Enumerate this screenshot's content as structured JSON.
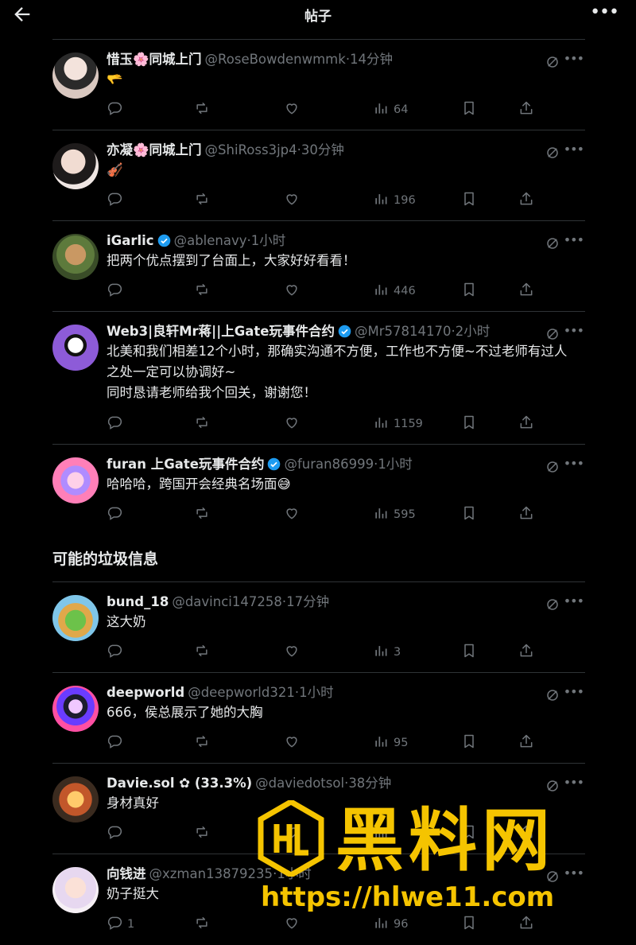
{
  "header": {
    "title": "帖子"
  },
  "section_label": "可能的垃圾信息",
  "posts": [
    {
      "name": "惜玉🌸同城上门",
      "verified": false,
      "handle": "@RoseBowdenwmmk",
      "time": "14分钟",
      "text": "🫳",
      "replies": "",
      "reposts": "",
      "likes": "",
      "views": "64"
    },
    {
      "name": "亦凝🌸同城上门",
      "verified": false,
      "handle": "@ShiRoss3jp4",
      "time": "30分钟",
      "text": "🎻",
      "replies": "",
      "reposts": "",
      "likes": "",
      "views": "196"
    },
    {
      "name": "iGarlic",
      "verified": true,
      "handle": "@ablenavy",
      "time": "1小时",
      "text": "把两个优点摆到了台面上，大家好好看看！",
      "replies": "",
      "reposts": "",
      "likes": "",
      "views": "446"
    },
    {
      "name": "Web3|良轩Mr蒋||上Gate玩事件合约",
      "verified": true,
      "handle": "@Mr57814170",
      "time": "2小时",
      "text": "北美和我们相差12个小时，那确实沟通不方便，工作也不方便~不过老师有过人之处一定可以协调好~\n同时恳请老师给我个回关，谢谢您！",
      "replies": "",
      "reposts": "",
      "likes": "",
      "views": "1159"
    },
    {
      "name": "furan 上Gate玩事件合约",
      "verified": true,
      "handle": "@furan86999",
      "time": "1小时",
      "text": "哈哈哈，跨国开会经典名场面😅",
      "replies": "",
      "reposts": "",
      "likes": "",
      "views": "595"
    },
    {
      "name": "bund_18",
      "verified": false,
      "handle": "@davinci147258",
      "time": "17分钟",
      "text": "这大奶",
      "replies": "",
      "reposts": "",
      "likes": "",
      "views": "3"
    },
    {
      "name": "deepworld",
      "verified": false,
      "handle": "@deepworld321",
      "time": "1小时",
      "text": "666，侯总展示了她的大胸",
      "replies": "",
      "reposts": "",
      "likes": "",
      "views": "95"
    },
    {
      "name": "Davie.sol ✿ (33.3%)",
      "verified": false,
      "handle": "@daviedotsol",
      "time": "38分钟",
      "text": "身材真好",
      "replies": "",
      "reposts": "",
      "likes": "",
      "views": ""
    },
    {
      "name": "向钱进",
      "verified": false,
      "handle": "@xzman13879235",
      "time": "1小时",
      "text": "奶子挺大",
      "replies": "1",
      "reposts": "",
      "likes": "",
      "views": "96"
    }
  ],
  "watermark": {
    "brand": "黑料网",
    "url": "https://hlwe11.com"
  },
  "colors": {
    "background": "#000000",
    "text": "#e7e9ea",
    "muted": "#71767b",
    "divider": "#2f3336",
    "verified": "#1d9bf0",
    "watermark": "#f5c400"
  }
}
